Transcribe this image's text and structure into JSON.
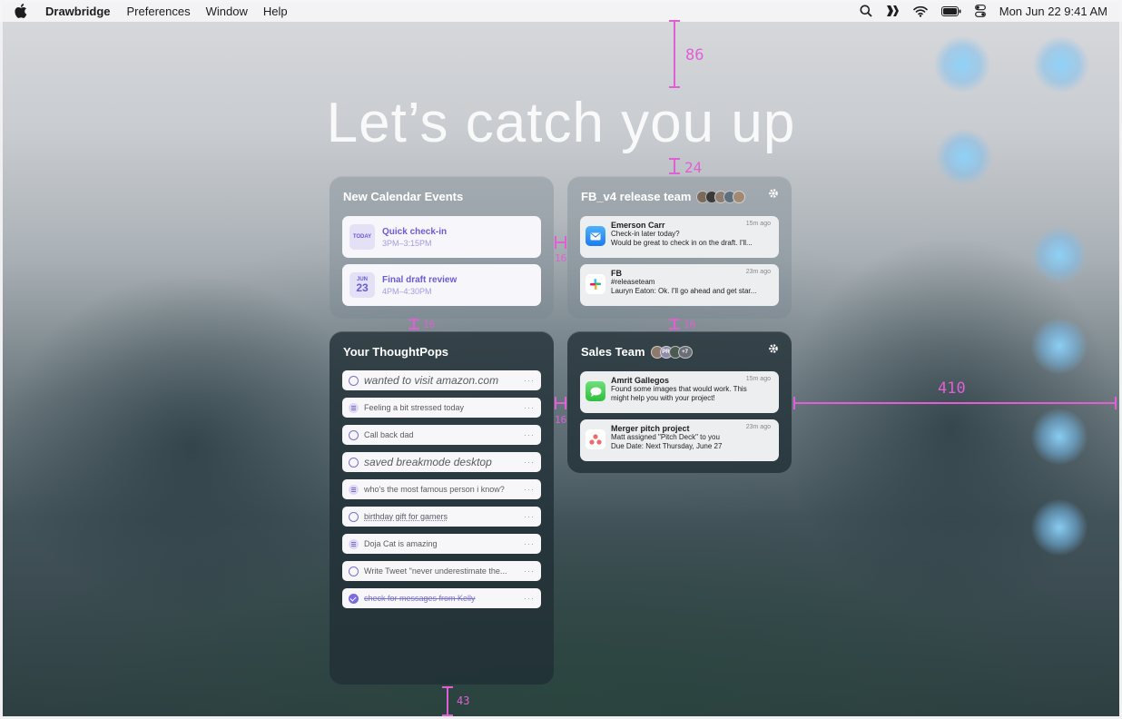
{
  "menubar": {
    "app_name": "Drawbridge",
    "items": [
      "Preferences",
      "Window",
      "Help"
    ],
    "clock": "Mon Jun 22  9:41 AM"
  },
  "hero": {
    "title": "Let’s catch you up"
  },
  "annotations": {
    "top": "86",
    "title_gap": "24",
    "col_gap_top": "16",
    "col_gap_bottom": "16",
    "row_gap_left": "16",
    "row_gap_right": "16",
    "side": "410",
    "bottom": "43"
  },
  "calendar": {
    "title": "New Calendar Events",
    "events": [
      {
        "badge": "TODAY",
        "month": "",
        "day": "",
        "name": "Quick check-in",
        "time": "3PM–3:15PM"
      },
      {
        "badge": "",
        "month": "JUN",
        "day": "23",
        "name": "Final draft review",
        "time": "4PM–4:30PM"
      }
    ]
  },
  "release_team": {
    "title": "FB_v4 release team",
    "notifications": [
      {
        "app": "mail",
        "sender": "Emerson Carr",
        "time": "15m ago",
        "line1": "Check-in later today?",
        "line2": "Would be great to check in on the draft. I'll..."
      },
      {
        "app": "slack",
        "sender": "FB",
        "time": "23m ago",
        "line1": "#releaseteam",
        "line2": "Lauryn Eaton: Ok. I'll go ahead and get star..."
      }
    ]
  },
  "thoughtpops": {
    "title": "Your ThoughtPops",
    "items": [
      {
        "icon": "ring",
        "text": "wanted to visit amazon.com",
        "style": "big"
      },
      {
        "icon": "note",
        "text": "Feeling a bit stressed today",
        "style": ""
      },
      {
        "icon": "ring",
        "text": "Call back dad",
        "style": ""
      },
      {
        "icon": "ring",
        "text": "saved breakmode desktop",
        "style": "big"
      },
      {
        "icon": "note",
        "text": "who's the most famous person i know?",
        "style": ""
      },
      {
        "icon": "ring",
        "text": "birthday gift for gamers",
        "style": "dotted"
      },
      {
        "icon": "note",
        "text": "Doja Cat is amazing",
        "style": ""
      },
      {
        "icon": "ring",
        "text": "Write Tweet \"never underestimate the...",
        "style": ""
      },
      {
        "icon": "check",
        "text": "check for messages from Kelly",
        "style": "done"
      }
    ],
    "more_label": "···"
  },
  "sales": {
    "title": "Sales Team",
    "extra_avatars": "+7",
    "notifications": [
      {
        "app": "messages",
        "sender": "Amrit Gallegos",
        "time": "15m ago",
        "line1": "Found some images that would work. This",
        "line2": "might help you with your project!"
      },
      {
        "app": "asana",
        "sender": "Merger pitch project",
        "time": "23m ago",
        "line1": "Matt assigned \"Pitch Deck\" to you",
        "line2": "Due Date: Next Thursday, June 27"
      }
    ]
  },
  "colors": {
    "accent": "#6a5bd6",
    "annotation": "#e05fd5"
  }
}
